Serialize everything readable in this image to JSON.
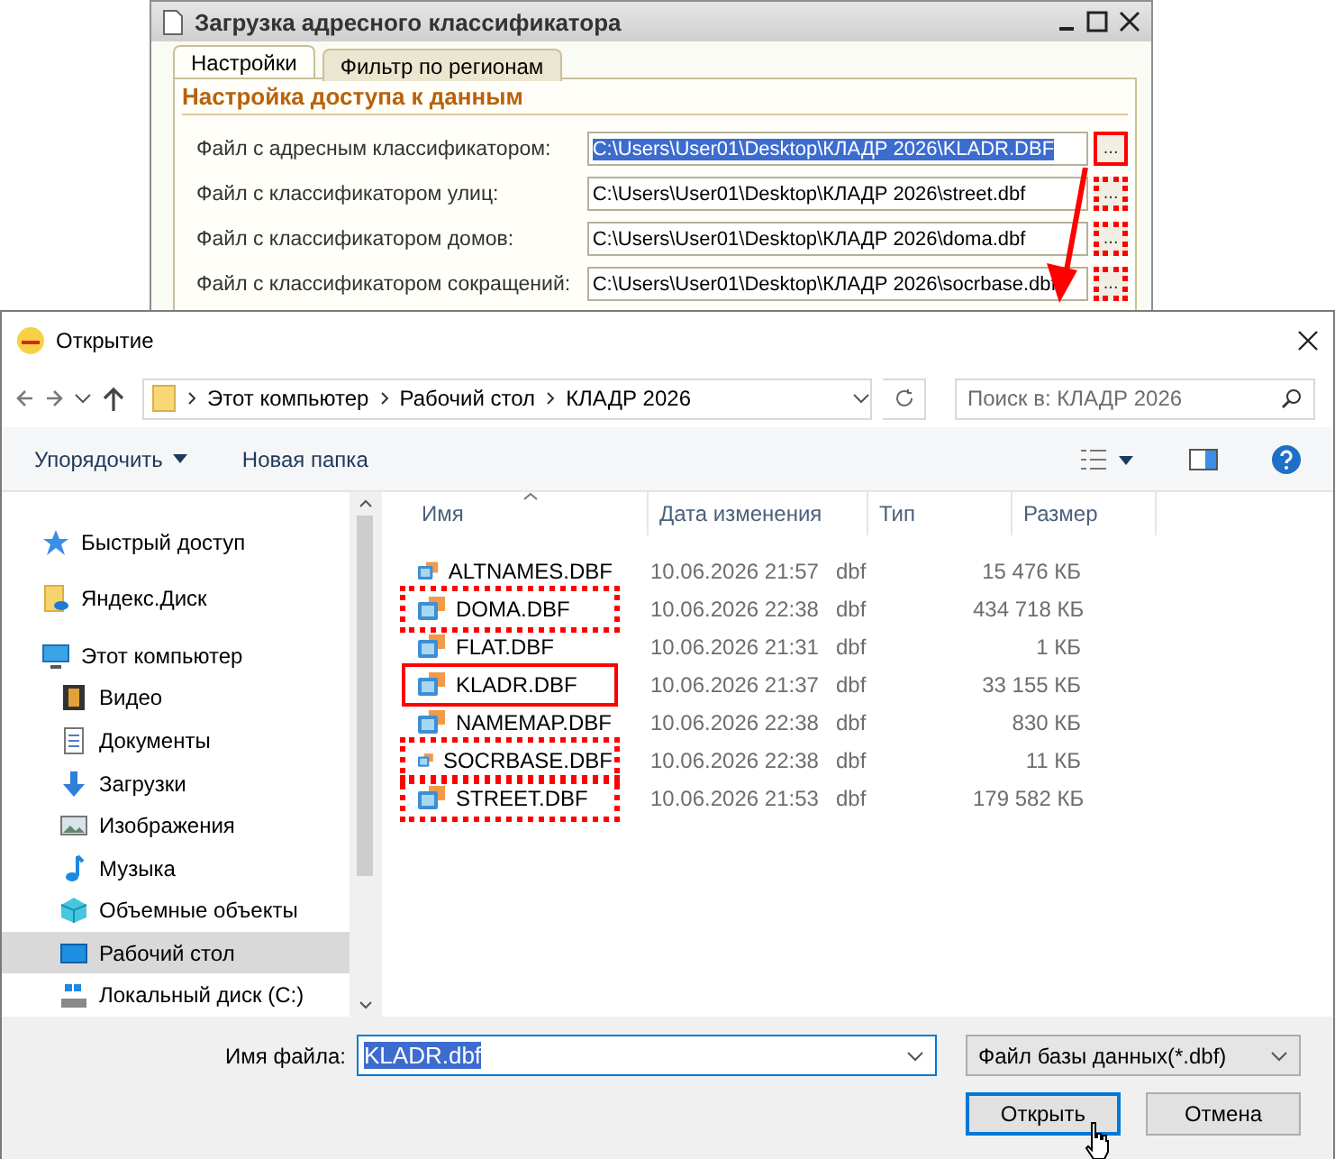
{
  "background_window": {
    "title": "Загрузка адресного классификатора",
    "tabs": [
      {
        "label": "Настройки",
        "selected": true
      },
      {
        "label": "Фильтр по регионам",
        "selected": false
      }
    ],
    "section_title": "Настройка доступа к данным",
    "fields": [
      {
        "label": "Файл с адресным классификатором:",
        "value": "C:\\Users\\User01\\Desktop\\КЛАДР 2026\\KLADR.DBF",
        "selected": true,
        "button": "...",
        "outlined": true,
        "dashed": false
      },
      {
        "label": "Файл с классификатором улиц:",
        "value": "C:\\Users\\User01\\Desktop\\КЛАДР 2026\\street.dbf",
        "selected": false,
        "button": "...",
        "outlined": true,
        "dashed": true
      },
      {
        "label": "Файл с классификатором домов:",
        "value": "C:\\Users\\User01\\Desktop\\КЛАДР 2026\\doma.dbf",
        "selected": false,
        "button": "...",
        "outlined": true,
        "dashed": true
      },
      {
        "label": "Файл с классификатором сокращений:",
        "value": "C:\\Users\\User01\\Desktop\\КЛАДР 2026\\socrbase.dbf",
        "selected": false,
        "button": "...",
        "outlined": true,
        "dashed": true
      }
    ]
  },
  "dialog": {
    "title": "Открытие",
    "path": [
      "Этот компьютер",
      "Рабочий стол",
      "КЛАДР 2026"
    ],
    "search": {
      "placeholder": "Поиск в: КЛАДР 2026"
    },
    "toolbar": {
      "organize": "Упорядочить",
      "new_folder": "Новая папка"
    },
    "sidebar": [
      {
        "label": "Быстрый доступ",
        "kind": "star",
        "selected": false
      },
      {
        "label": "Яндекс.Диск",
        "kind": "cloud",
        "selected": false
      },
      {
        "label": "Этот компьютер",
        "kind": "computer",
        "selected": false,
        "children": [
          {
            "label": "Видео",
            "kind": "video",
            "selected": false
          },
          {
            "label": "Документы",
            "kind": "documents",
            "selected": false
          },
          {
            "label": "Загрузки",
            "kind": "downloads",
            "selected": false
          },
          {
            "label": "Изображения",
            "kind": "images",
            "selected": false
          },
          {
            "label": "Музыка",
            "kind": "music",
            "selected": false
          },
          {
            "label": "Объемные объекты",
            "kind": "objects",
            "selected": false
          },
          {
            "label": "Рабочий стол",
            "kind": "desktop",
            "selected": true
          },
          {
            "label": "Локальный диск (C:)",
            "kind": "drive",
            "selected": false
          }
        ]
      }
    ],
    "columns": [
      {
        "label": "Имя",
        "sorted": true
      },
      {
        "label": "Дата изменения",
        "sorted": false
      },
      {
        "label": "Тип",
        "sorted": false
      },
      {
        "label": "Размер",
        "sorted": false
      }
    ],
    "files": [
      {
        "name": "ALTNAMES.DBF",
        "modified": "10.06.2026 21:57",
        "type": "dbf",
        "size": "15 476 КБ",
        "outlined": false
      },
      {
        "name": "DOMA.DBF",
        "modified": "10.06.2026 22:38",
        "type": "dbf",
        "size": "434 718 КБ",
        "outlined": true,
        "dashed": true
      },
      {
        "name": "FLAT.DBF",
        "modified": "10.06.2026 21:31",
        "type": "dbf",
        "size": "1 КБ",
        "outlined": false
      },
      {
        "name": "KLADR.DBF",
        "modified": "10.06.2026 21:37",
        "type": "dbf",
        "size": "33 155 КБ",
        "outlined": true,
        "dashed": false
      },
      {
        "name": "NAMEMAP.DBF",
        "modified": "10.06.2026 22:38",
        "type": "dbf",
        "size": "830 КБ",
        "outlined": false
      },
      {
        "name": "SOCRBASE.DBF",
        "modified": "10.06.2026 22:38",
        "type": "dbf",
        "size": "11 КБ",
        "outlined": true,
        "dashed": true
      },
      {
        "name": "STREET.DBF",
        "modified": "10.06.2026 21:53",
        "type": "dbf",
        "size": "179 582 КБ",
        "outlined": true,
        "dashed": true
      }
    ],
    "file_name": {
      "label": "Имя файла:",
      "value": "KLADR.dbf",
      "selected": true
    },
    "filter": "Файл базы данных(*.dbf)",
    "buttons": [
      {
        "label": "Открыть",
        "default": true
      },
      {
        "label": "Отмена",
        "default": false
      }
    ]
  }
}
